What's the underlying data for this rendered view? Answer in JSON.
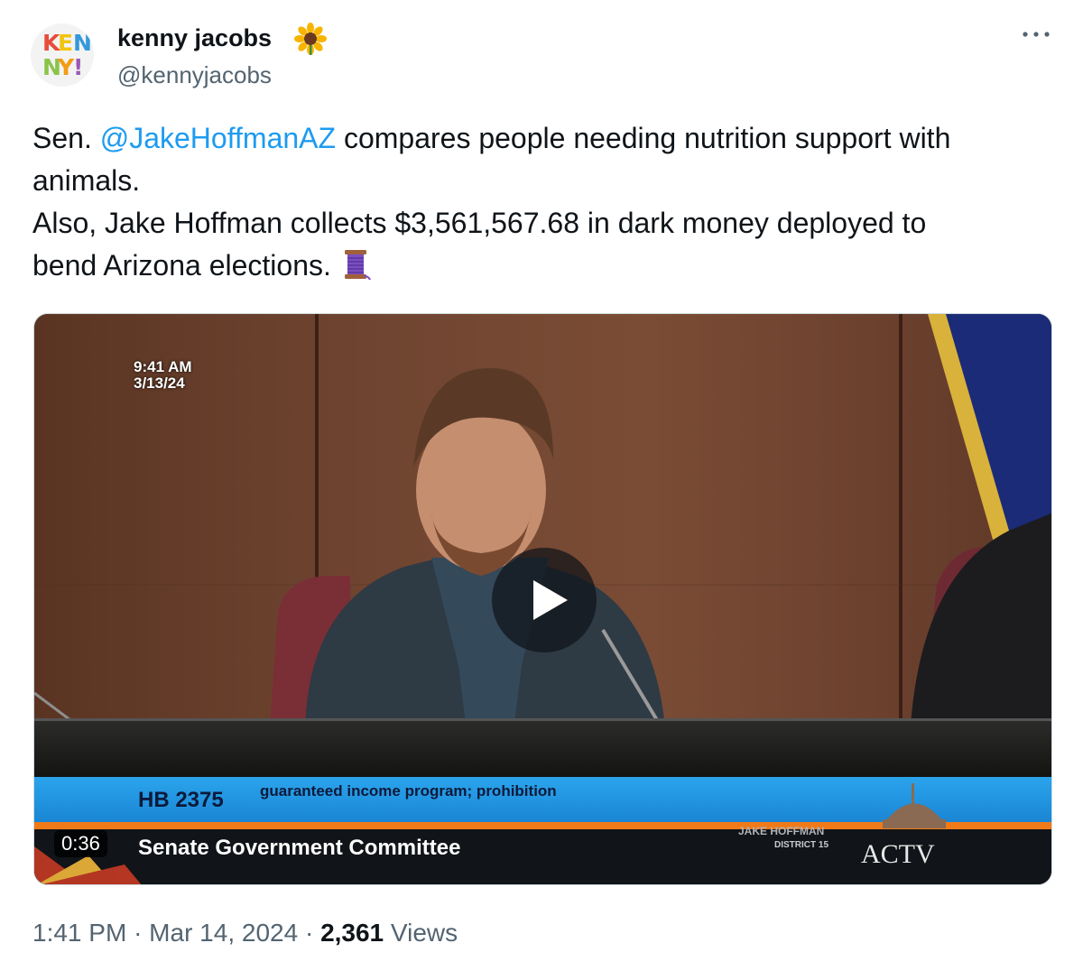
{
  "author": {
    "display_name": "kenny jacobs",
    "display_name_emoji_icon": "sunflower-icon",
    "handle": "@kennyjacobs",
    "avatar_text": [
      "KEN",
      "NY!"
    ]
  },
  "more_icon": "more-dots-icon",
  "tweet": {
    "line1_pre": "Sen. ",
    "mention": "@JakeHoffmanAZ",
    "line1_post": " compares people needing nutrition support with",
    "line2": "animals.",
    "line3": "Also, Jake Hoffman collects $3,561,567.68 in dark money deployed to",
    "line4": "bend Arizona elections.",
    "trailing_emoji_icon": "thread-spool-icon"
  },
  "video": {
    "overlay_time": "9:41 AM",
    "overlay_date": "3/13/24",
    "bill_number": "HB 2375",
    "bill_title": "guaranteed income program; prohibition",
    "committee": "Senate Government Committee",
    "nameplate_name": "JAKE HOFFMAN",
    "nameplate_district": "DISTRICT 15",
    "channel_logo": "ACTV",
    "duration": "0:36",
    "play_icon": "play-icon"
  },
  "meta": {
    "time": "1:41 PM",
    "separator": "·",
    "date": "Mar 14, 2024",
    "views_count": "2,361",
    "views_label": "Views"
  },
  "colors": {
    "link": "#1d9bf0",
    "secondary_text": "#536471",
    "lower_third_blue": "#1f98e4"
  }
}
